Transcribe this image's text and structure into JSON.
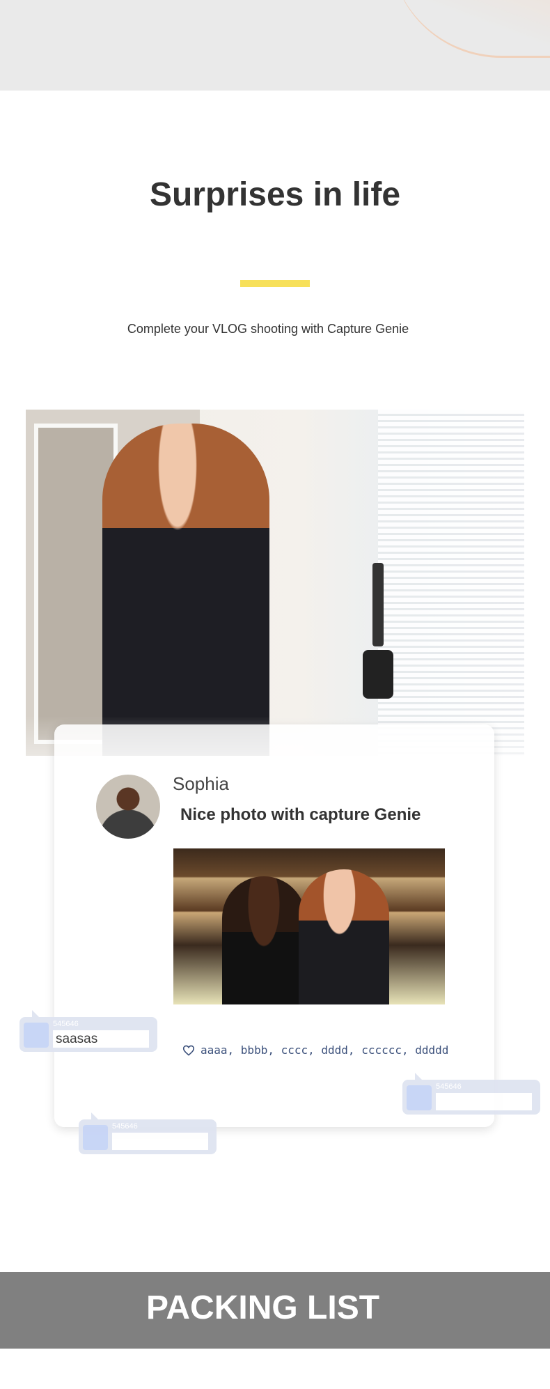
{
  "section": {
    "title": "Surprises in life",
    "subtitle": "Complete your VLOG shooting with Capture Genie",
    "accent_color": "#f7e05a"
  },
  "post": {
    "username": "Sophia",
    "caption": "Nice photo with capture Genie",
    "likes": "aaaa, bbbb, cccc, dddd, cccccc, ddddd",
    "like_icon": "heart-icon"
  },
  "comments": [
    {
      "id": "545646",
      "text": "saasas"
    },
    {
      "id": "545646",
      "text": ""
    },
    {
      "id": "545646",
      "text": ""
    }
  ],
  "packing": {
    "title": "PACKING LIST",
    "band_color": "#808080"
  }
}
